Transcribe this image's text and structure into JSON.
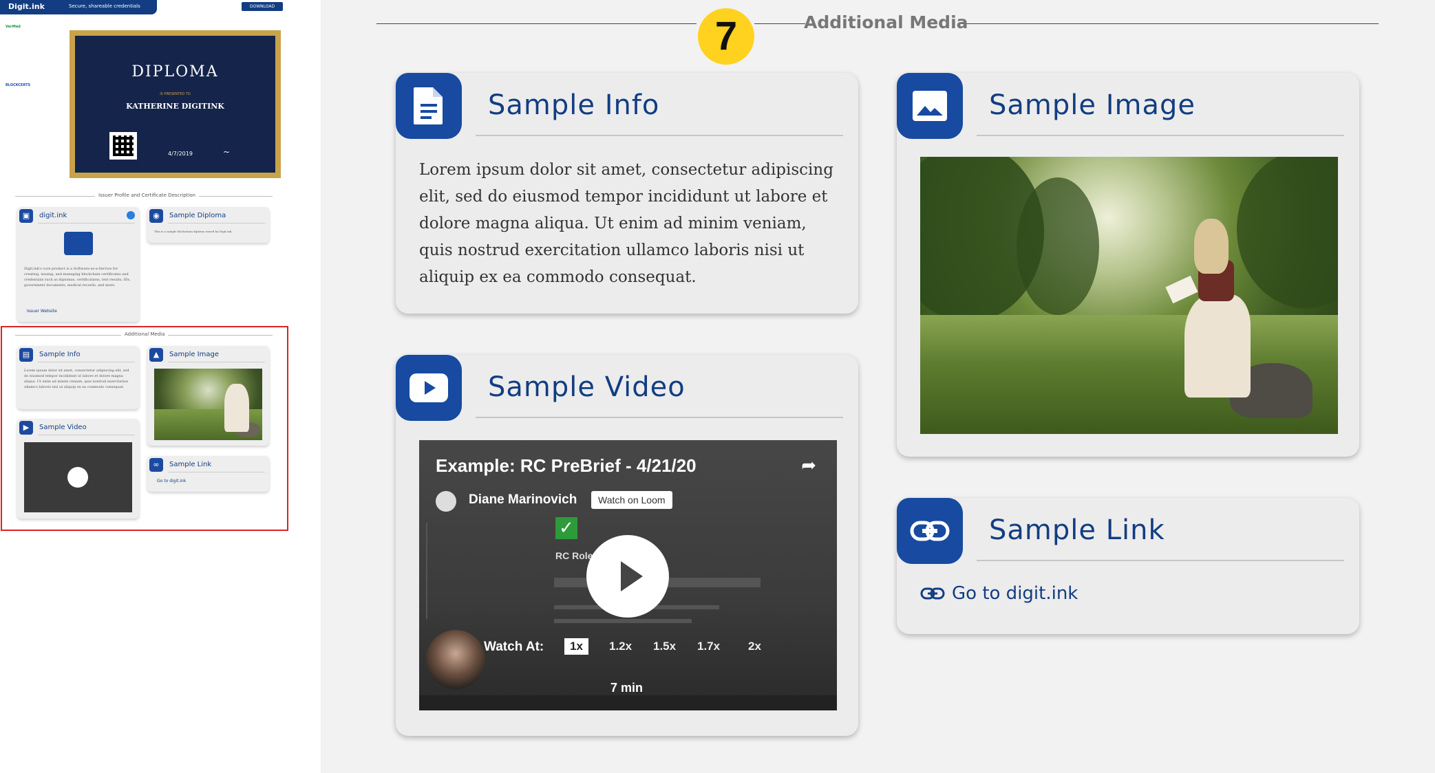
{
  "thumb": {
    "logo": "Digit.ink",
    "tagline": "Secure, shareable credentials",
    "download": "DOWNLOAD",
    "verified": "Verified",
    "blockcerts": "BLOCKCERTS",
    "diploma_title": "DIPLOMA",
    "presented": "IS PRESENTED TO",
    "recipient": "KATHERINE DIGITINK",
    "date": "4/7/2019",
    "section1": "Issuer Profile and Certificate Description",
    "issuer_name": "digit.ink",
    "issuer_desc": "Digit.ink's core product is a Software-as-a-Service for creating, issuing, and managing blockchain certificates and credentials such as diplomas, certifications, test results, IDs, government documents, medical records, and more.",
    "issuer_link": "Issuer Website",
    "cred_name": "Sample Diploma",
    "cred_desc": "This is a sample blockchain diploma issued by Digit.ink.",
    "section2": "Additional Media",
    "info_title": "Sample Info",
    "info_body": "Lorem ipsum dolor sit amet, consectetur adipiscing elit, sed do eiusmod tempor incididunt ut labore et dolore magna aliqua. Ut enim ad minim veniam, quis nostrud exercitation ullamco laboris nisi ut aliquip ex ea commodo consequat.",
    "image_title": "Sample Image",
    "video_title": "Sample Video",
    "link_title": "Sample Link",
    "link_text": "Go to digit.ink"
  },
  "main": {
    "step_number": "7",
    "section_title": "Additional Media",
    "info": {
      "title": "Sample Info",
      "body": "Lorem ipsum dolor sit amet, consectetur adipiscing elit, sed do eiusmod tempor incididunt ut labore et dolore magna aliqua. Ut enim ad minim veniam, quis nostrud exercitation ullamco laboris nisi ut aliquip ex ea commodo consequat."
    },
    "image": {
      "title": "Sample Image"
    },
    "video": {
      "title": "Sample Video",
      "player_title": "Example: RC PreBrief - 4/21/20",
      "presenter": "Diane Marinovich",
      "watch_on": "Watch on Loom",
      "watch_at": "Watch At:",
      "speeds": [
        "1x",
        "1.2x",
        "1.5x",
        "1.7x",
        "2x"
      ],
      "selected_speed": "1x",
      "duration": "7 min",
      "rc_label": "RC Role"
    },
    "link": {
      "title": "Sample Link",
      "text": "Go to digit.ink"
    }
  },
  "colors": {
    "brand": "#174aa0",
    "badge": "#ffd21f",
    "highlight": "#dd2222"
  },
  "icons": [
    "document-icon",
    "image-icon",
    "play-icon",
    "link-icon",
    "bank-icon",
    "verified-icon",
    "share-icon",
    "check-icon"
  ]
}
